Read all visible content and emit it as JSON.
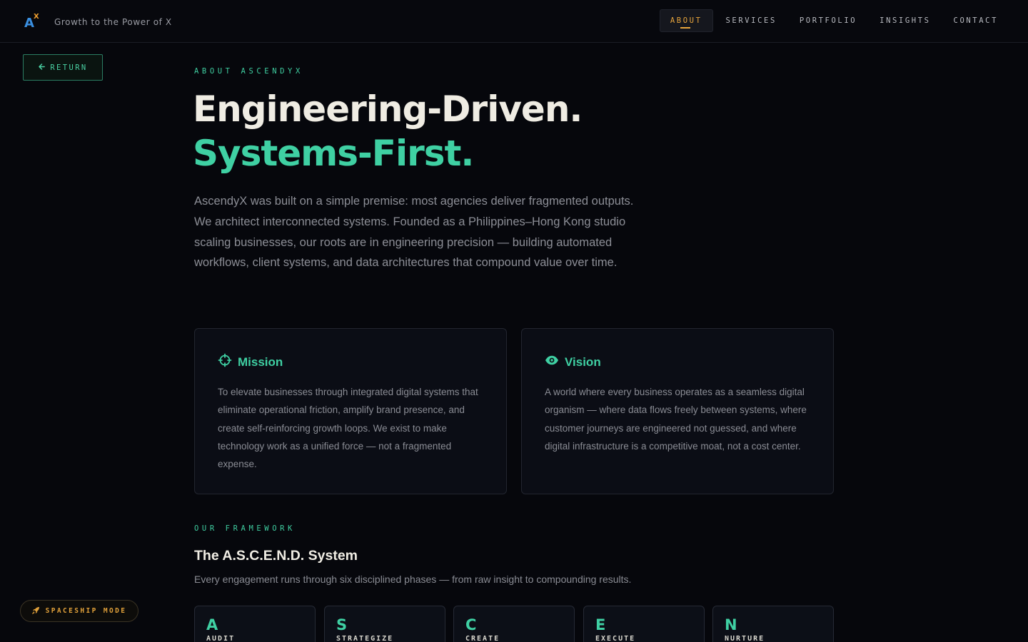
{
  "header": {
    "logo_letter": "A",
    "logo_superscript": "X",
    "tagline": "Growth to the Power of X",
    "nav": [
      {
        "label": "ABOUT",
        "active": true
      },
      {
        "label": "SERVICES",
        "active": false
      },
      {
        "label": "PORTFOLIO",
        "active": false
      },
      {
        "label": "INSIGHTS",
        "active": false
      },
      {
        "label": "CONTACT",
        "active": false
      }
    ]
  },
  "return_button": {
    "label": "RETURN",
    "icon": "arrow-left-icon"
  },
  "hero": {
    "eyebrow": "ABOUT ASCENDYX",
    "title_line1": "Engineering-Driven.",
    "title_line2": "Systems-First.",
    "intro": "AscendyX was built on a simple premise: most agencies deliver fragmented outputs. We architect interconnected systems. Founded as a Philippines–Hong Kong studio scaling businesses, our roots are in engineering precision — building automated workflows, client systems, and data architectures that compound value over time."
  },
  "cards": [
    {
      "icon": "crosshair-icon",
      "title": "Mission",
      "body": "To elevate businesses through integrated digital systems that eliminate operational friction, amplify brand presence, and create self-reinforcing growth loops. We exist to make technology work as a unified force — not a fragmented expense."
    },
    {
      "icon": "eye-icon",
      "title": "Vision",
      "body": "A world where every business operates as a seamless digital organism — where data flows freely between systems, where customer journeys are engineered not guessed, and where digital infrastructure is a competitive moat, not a cost center."
    }
  ],
  "framework": {
    "eyebrow": "OUR FRAMEWORK",
    "title": "The A.S.C.E.N.D. System",
    "subtitle": "Every engagement runs through six disciplined phases — from raw insight to compounding results.",
    "phases": [
      {
        "letter": "A",
        "name": "AUDIT"
      },
      {
        "letter": "S",
        "name": "STRATEGIZE"
      },
      {
        "letter": "C",
        "name": "CREATE"
      },
      {
        "letter": "E",
        "name": "EXECUTE"
      },
      {
        "letter": "N",
        "name": "NURTURE"
      }
    ]
  },
  "spaceship_button": {
    "label": "SPACESHIP MODE",
    "icon": "rocket-icon"
  },
  "colors": {
    "accent": "#3fd0a3",
    "nav_active": "#e8a53c",
    "background": "#06070c"
  }
}
